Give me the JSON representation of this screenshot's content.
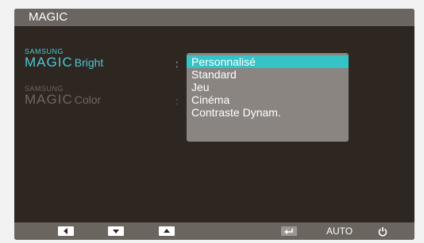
{
  "title": "MAGIC",
  "menu": {
    "items": [
      {
        "brand_top": "SAMSUNG",
        "brand_main": "MAGIC",
        "suffix": "Bright",
        "colon": ":",
        "active": true
      },
      {
        "brand_top": "SAMSUNG",
        "brand_main": "MAGIC",
        "suffix": "Color",
        "colon": ":",
        "active": false
      }
    ]
  },
  "dropdown": {
    "selected_index": 0,
    "options": [
      "Personnalisé",
      "Standard",
      "Jeu",
      "Cinéma",
      "Contraste Dynam."
    ]
  },
  "bottom_bar": {
    "buttons": [
      {
        "icon": "left-arrow-icon"
      },
      {
        "icon": "down-arrow-icon"
      },
      {
        "icon": "up-arrow-icon"
      },
      {
        "icon": "enter-icon"
      },
      {
        "label": "AUTO"
      },
      {
        "icon": "power-icon"
      }
    ]
  },
  "colors": {
    "accent": "#35c3c6",
    "brand_active": "#4cc9d6",
    "panel": "#2e2620",
    "bar": "#6b6560"
  }
}
